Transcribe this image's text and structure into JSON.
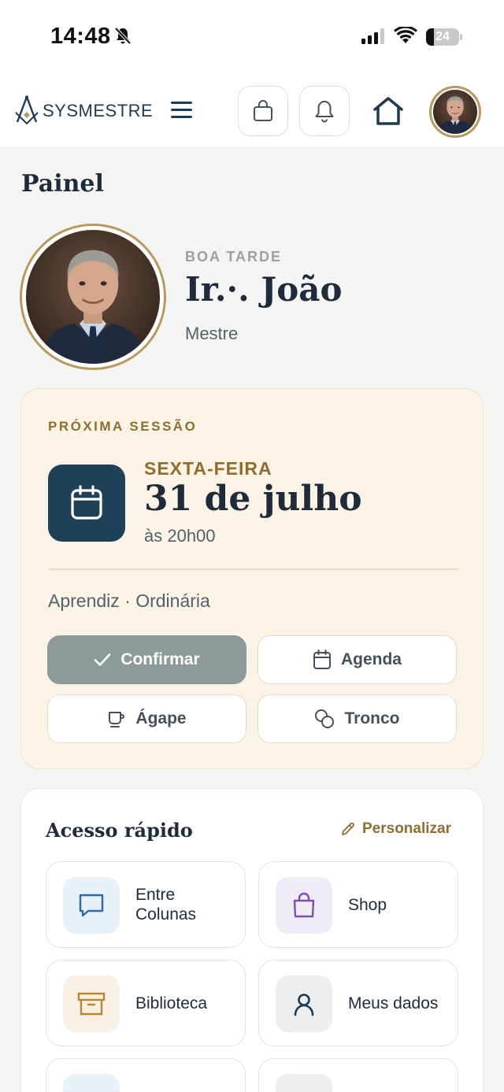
{
  "status_bar": {
    "time": "14:48",
    "battery_pct": "24",
    "battery_level": 0.24
  },
  "header": {
    "logo_sys": "SYS",
    "logo_mestre": "MESTRE",
    "icons": [
      "logo-icon",
      "menu-icon",
      "bag-icon",
      "bell-icon",
      "home-icon",
      "avatar"
    ]
  },
  "page": {
    "title": "Painel"
  },
  "profile": {
    "greeting": "BOA TARDE",
    "name": "Ir.·. João",
    "degree": "Mestre"
  },
  "next_session": {
    "label": "PRÓXIMA SESSÃO",
    "weekday": "SEXTA-FEIRA",
    "date": "31 de julho",
    "time": "às 20h00",
    "type": "Aprendiz · Ordinária",
    "buttons": {
      "confirm": "Confirmar",
      "agenda": "Agenda",
      "agape": "Ágape",
      "tronco": "Tronco"
    }
  },
  "quick_access": {
    "title": "Acesso rápido",
    "customize": "Personalizar",
    "tiles": [
      {
        "label": "Entre Colunas",
        "icon": "chat-icon",
        "bg": "#e8f0f8",
        "color": "#2f6aa3"
      },
      {
        "label": "Shop",
        "icon": "bag-icon",
        "bg": "#f0ecf6",
        "color": "#7a4fb0"
      },
      {
        "label": "Biblioteca",
        "icon": "archive-icon",
        "bg": "#f8f0e4",
        "color": "#b8862f"
      },
      {
        "label": "Meus dados",
        "icon": "user-icon",
        "bg": "#eceef0",
        "color": "#1f3b52"
      }
    ]
  },
  "colors": {
    "navy": "#1f4158",
    "gold": "#8e6d2f",
    "cream": "#fbf3e6",
    "confirm_button": "#8d9a9a"
  }
}
